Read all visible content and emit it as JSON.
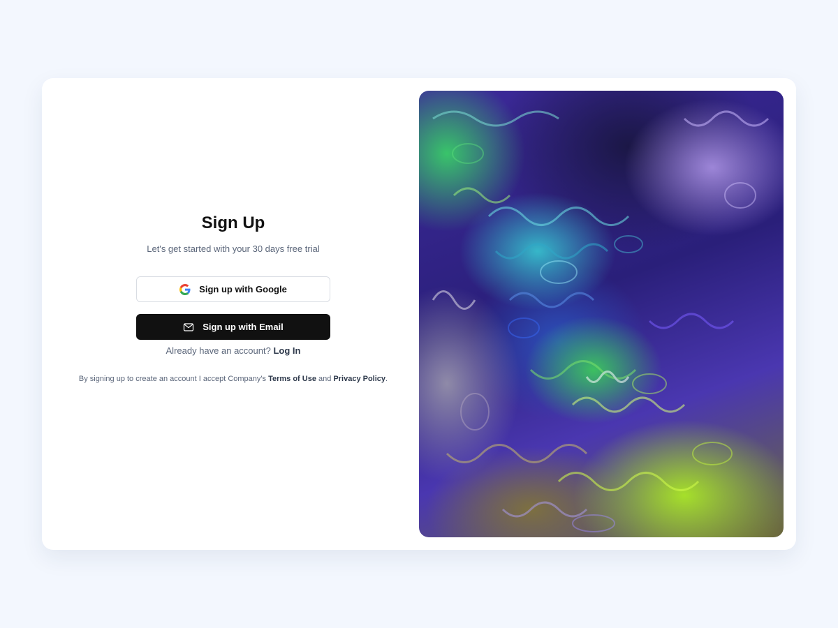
{
  "signup": {
    "title": "Sign Up",
    "subtitle": "Let's get started with your 30 days free trial",
    "google_button_label": "Sign up with Google",
    "email_button_label": "Sign up with Email",
    "login_prompt": "Already have an account?",
    "login_link": "Log In",
    "legal_prefix": "By signing up to create an account I accept Company's",
    "terms_link": "Terms of Use",
    "legal_and": "and",
    "privacy_link": "Privacy Policy",
    "legal_suffix": "."
  },
  "icons": {
    "google": "google-icon",
    "email": "mail-icon"
  },
  "colors": {
    "background": "#f3f7fe",
    "card": "#ffffff",
    "primary_button": "#111111",
    "text_muted": "#5b667a",
    "link": "#2f3a4c"
  }
}
